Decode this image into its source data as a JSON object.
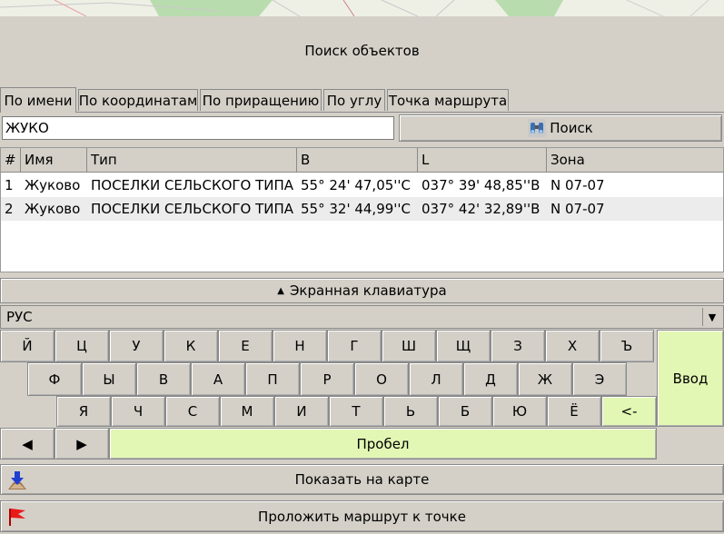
{
  "window": {
    "title": "Поиск объектов"
  },
  "tabs": [
    {
      "label": "По имени"
    },
    {
      "label": "По координатам"
    },
    {
      "label": "По приращению"
    },
    {
      "label": "По углу"
    },
    {
      "label": "Точка маршрута"
    }
  ],
  "search": {
    "value": "ЖУКО",
    "button_label": "Поиск"
  },
  "table": {
    "columns": [
      "#",
      "Имя",
      "Тип",
      "B",
      "L",
      "Зона"
    ],
    "rows": [
      [
        "1",
        "Жуково",
        "ПОСЕЛКИ СЕЛЬСКОГО ТИПА",
        "55° 24' 47,05''С",
        "037° 39' 48,85''В",
        "N 07-07"
      ],
      [
        "2",
        "Жуково",
        "ПОСЕЛКИ СЕЛЬСКОГО ТИПА",
        "55° 32' 44,99''С",
        "037° 42' 32,89''В",
        "N 07-07"
      ]
    ]
  },
  "keyboard": {
    "toggle_label": "Экранная клавиатура",
    "layout": "РУС",
    "row1": [
      "Й",
      "Ц",
      "У",
      "К",
      "Е",
      "Н",
      "Г",
      "Ш",
      "Щ",
      "З",
      "Х",
      "Ъ"
    ],
    "row2": [
      "Ф",
      "Ы",
      "В",
      "А",
      "П",
      "Р",
      "О",
      "Л",
      "Д",
      "Ж",
      "Э"
    ],
    "row3": [
      "Я",
      "Ч",
      "С",
      "М",
      "И",
      "Т",
      "Ь",
      "Б",
      "Ю",
      "Ё"
    ],
    "backspace_label": "<-",
    "enter_label": "Ввод",
    "space_label": "Пробел"
  },
  "actions": {
    "show_on_map": "Показать на карте",
    "route_to_point": "Проложить маршрут к точке"
  },
  "colors": {
    "accent_green": "#e2f7b4",
    "panel": "#d4d0c8",
    "row_alt": "#ececec"
  }
}
